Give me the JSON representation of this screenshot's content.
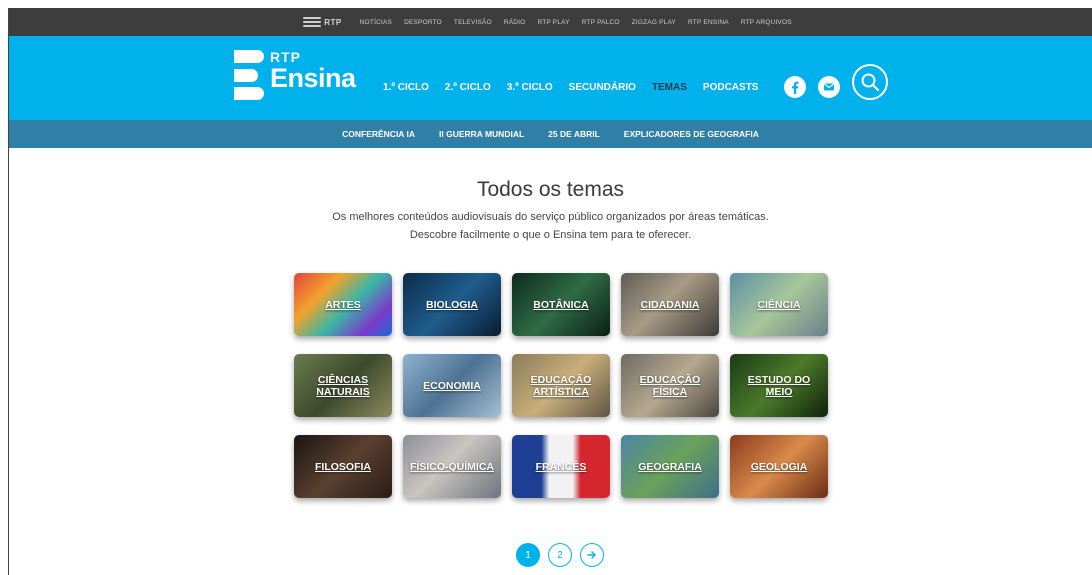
{
  "rtp_bar": {
    "logo_text": "RTP",
    "links": [
      "NOTÍCIAS",
      "DESPORTO",
      "TELEVISÃO",
      "RÁDIO",
      "RTP PLAY",
      "RTP PALCO",
      "ZIGZAG PLAY",
      "RTP ENSINA",
      "RTP ARQUIVOS"
    ]
  },
  "header": {
    "logo_small": "RTP",
    "logo_big": "Ensina",
    "nav": [
      "1.º CICLO",
      "2.º CICLO",
      "3.º CICLO",
      "SECUNDÁRIO",
      "TEMAS",
      "PODCASTS"
    ],
    "active_nav": "TEMAS"
  },
  "subnav": [
    "CONFERÊNCIA IA",
    "II GUERRA MUNDIAL",
    "25 DE ABRIL",
    "EXPLICADORES DE GEOGRAFIA"
  ],
  "page": {
    "title": "Todos os temas",
    "lead_line1": "Os melhores conteúdos audiovisuais do serviço público organizados por áreas temáticas.",
    "lead_line2": "Descobre facilmente o que o Ensina tem para te oferecer."
  },
  "themes": [
    {
      "label": "ARTES",
      "bg": "linear-gradient(135deg,#e2453b 0%,#f2a22d 30%,#3bb6a6 55%,#7a3ac9 80%,#1d6bd6 100%)"
    },
    {
      "label": "BIOLOGIA",
      "bg": "linear-gradient(135deg,#0d2b4a 0%,#1f5d8c 50%,#0a1c33 100%)"
    },
    {
      "label": "BOTÂNICA",
      "bg": "linear-gradient(135deg,#0e2a1e 0%,#2f6b45 50%,#0b1f16 100%)"
    },
    {
      "label": "CIDADANIA",
      "bg": "linear-gradient(135deg,#5d5a55 0%,#a89b86 45%,#3d3a36 100%)"
    },
    {
      "label": "CIÊNCIA",
      "bg": "linear-gradient(135deg,#5b8fa4 0%,#a7c79a 50%,#6a7f8d 100%)"
    },
    {
      "label": "CIÊNCIAS NATURAIS",
      "bg": "linear-gradient(135deg,#6a7d4e 0%,#3d4a2c 50%,#8b8a5d 100%)"
    },
    {
      "label": "ECONOMIA",
      "bg": "linear-gradient(135deg,#8fb2cf 0%,#4d7293 50%,#a6bfd3 100%)"
    },
    {
      "label": "EDUCAÇÃO ARTÍSTICA",
      "bg": "linear-gradient(135deg,#8a7c5c 0%,#c9ae7a 50%,#5e5545 100%)"
    },
    {
      "label": "EDUCAÇÃO FÍSICA",
      "bg": "linear-gradient(135deg,#6d6a64 0%,#b6a88f 50%,#4a4640 100%)"
    },
    {
      "label": "ESTUDO DO MEIO",
      "bg": "linear-gradient(135deg,#1b3a14 0%,#4b7a2a 50%,#0f220c 100%)"
    },
    {
      "label": "FILOSOFIA",
      "bg": "linear-gradient(135deg,#1a1512 0%,#5a4030 50%,#2a1d16 100%)"
    },
    {
      "label": "FÍSICO-QUÍMICA",
      "bg": "linear-gradient(135deg,#8c8f9a 0%,#c9c5bf 45%,#6e7380 100%)"
    },
    {
      "label": "FRANCÊS",
      "bg": "linear-gradient(90deg,#1e3f94 0%,#1e3f94 30%,#f2f2f2 38%,#f2f2f2 62%,#d6262e 70%,#d6262e 100%)"
    },
    {
      "label": "GEOGRAFIA",
      "bg": "linear-gradient(135deg,#4c86a3 0%,#6aa15a 50%,#3f6f8a 100%)"
    },
    {
      "label": "GEOLOGIA",
      "bg": "linear-gradient(135deg,#8a3b1f 0%,#d98a4a 50%,#6b2c16 100%)"
    }
  ],
  "pagination": {
    "pages": [
      "1",
      "2"
    ],
    "current": "1",
    "next_icon": "arrow-right-icon"
  },
  "colors": {
    "brand": "#00b1ec",
    "subnav": "#2f7fa6",
    "topbar": "#3d3d3d",
    "active_nav": "#1b3b55"
  }
}
